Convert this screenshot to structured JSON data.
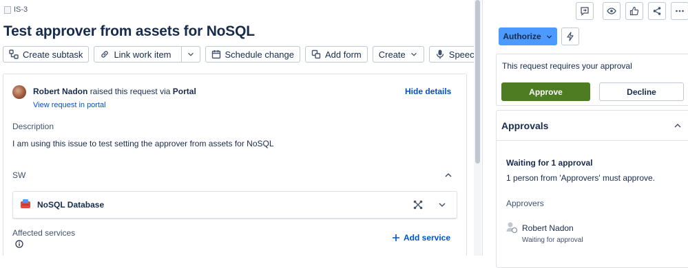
{
  "breadcrumb": {
    "issue_key": "IS-3"
  },
  "issue": {
    "title": "Test approver from assets for NoSQL"
  },
  "toolbar": {
    "create_subtask": "Create subtask",
    "link_work_item": "Link work item",
    "schedule_change": "Schedule change",
    "add_form": "Add form",
    "create": "Create",
    "speech": "Speech to"
  },
  "details": {
    "reporter": "Robert Nadon",
    "raised_text": "raised this request via",
    "channel": "Portal",
    "view_portal": "View request in portal",
    "hide_details": "Hide details",
    "description_label": "Description",
    "description_text": "I am using this issue to test setting the approver from assets for NoSQL",
    "sw_label": "SW",
    "asset_name": "NoSQL Database",
    "affected_label": "Affected services",
    "add_service": "Add service"
  },
  "sidebar": {
    "authorize_label": "Authorize",
    "approval_prompt": "This request requires your approval",
    "approve_label": "Approve",
    "decline_label": "Decline",
    "approvals_title": "Approvals",
    "waiting_text": "Waiting for 1 approval",
    "must_text": "1 person from 'Approvers' must approve.",
    "approvers_label": "Approvers",
    "approver_name": "Robert Nadon",
    "approver_status": "Waiting for approval"
  },
  "colors": {
    "approve": "#4d7c22",
    "authorize": "#4c9aff",
    "link": "#0052cc"
  }
}
